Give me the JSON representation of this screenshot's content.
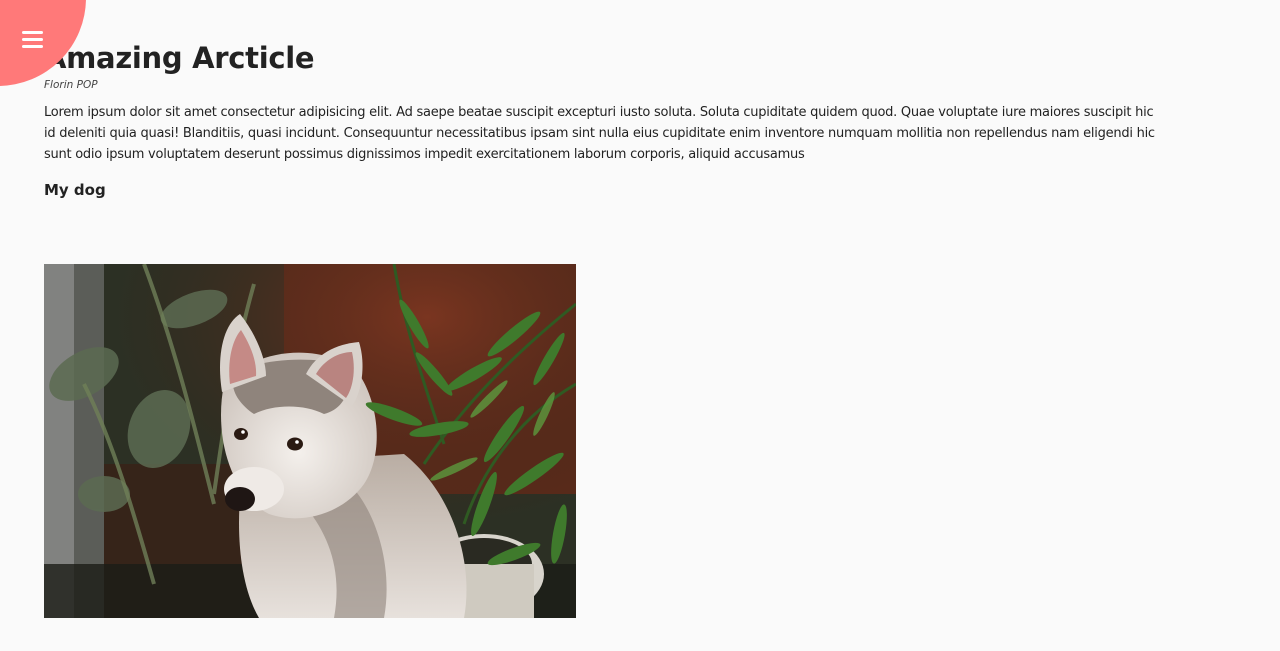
{
  "menu": {
    "icon": "hamburger-menu-icon",
    "color": "#ff7979"
  },
  "article": {
    "title": "Amazing Arcticle",
    "author": "Florin POP",
    "paragraph_lines": [
      "Lorem ipsum dolor sit amet consectetur adipisicing elit. Ad saepe beatae suscipit excepturi iusto soluta. Soluta cupiditate quidem quod. Quae voluptate iure maiores suscipit hic",
      "id deleniti quia quasi! Blanditiis, quasi incidunt. Consequuntur necessitatibus ipsam sint nulla eius cupiditate enim inventore numquam mollitia non repellendus nam eligendi hic",
      "sunt odio ipsum voluptatem deserunt possimus dignissimos impedit exercitationem laborum corporis, aliquid accusamus"
    ],
    "subheading": "My dog"
  },
  "image": {
    "subject": "husky puppy among green plants"
  },
  "colors": {
    "background": "#fafafa",
    "text": "#222222",
    "accent": "#ff7979"
  }
}
